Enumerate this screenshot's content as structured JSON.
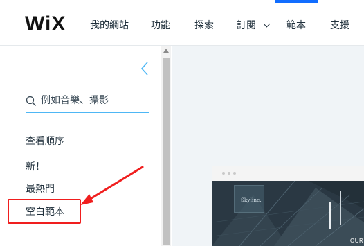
{
  "header": {
    "logo": "WiX",
    "nav": [
      {
        "label": "我的網站"
      },
      {
        "label": "功能"
      },
      {
        "label": "探索"
      },
      {
        "label": "訂閱"
      },
      {
        "label": "範本"
      },
      {
        "label": "支援"
      }
    ],
    "active_nav": "範本"
  },
  "sidebar": {
    "search": {
      "placeholder": "例如音樂、攝影"
    },
    "items": [
      {
        "label": "查看順序"
      },
      {
        "label": "新！"
      },
      {
        "label": "最熱門"
      },
      {
        "label": "空白範本"
      }
    ],
    "highlighted_item": "空白範本"
  },
  "preview": {
    "brand": "Skyline.",
    "corner_text": "OUR"
  },
  "colors": {
    "accent": "#116dff",
    "search_underline": "#4eb7f5",
    "annotation": "#f01e1e",
    "main_bg": "#f0f4f7"
  }
}
